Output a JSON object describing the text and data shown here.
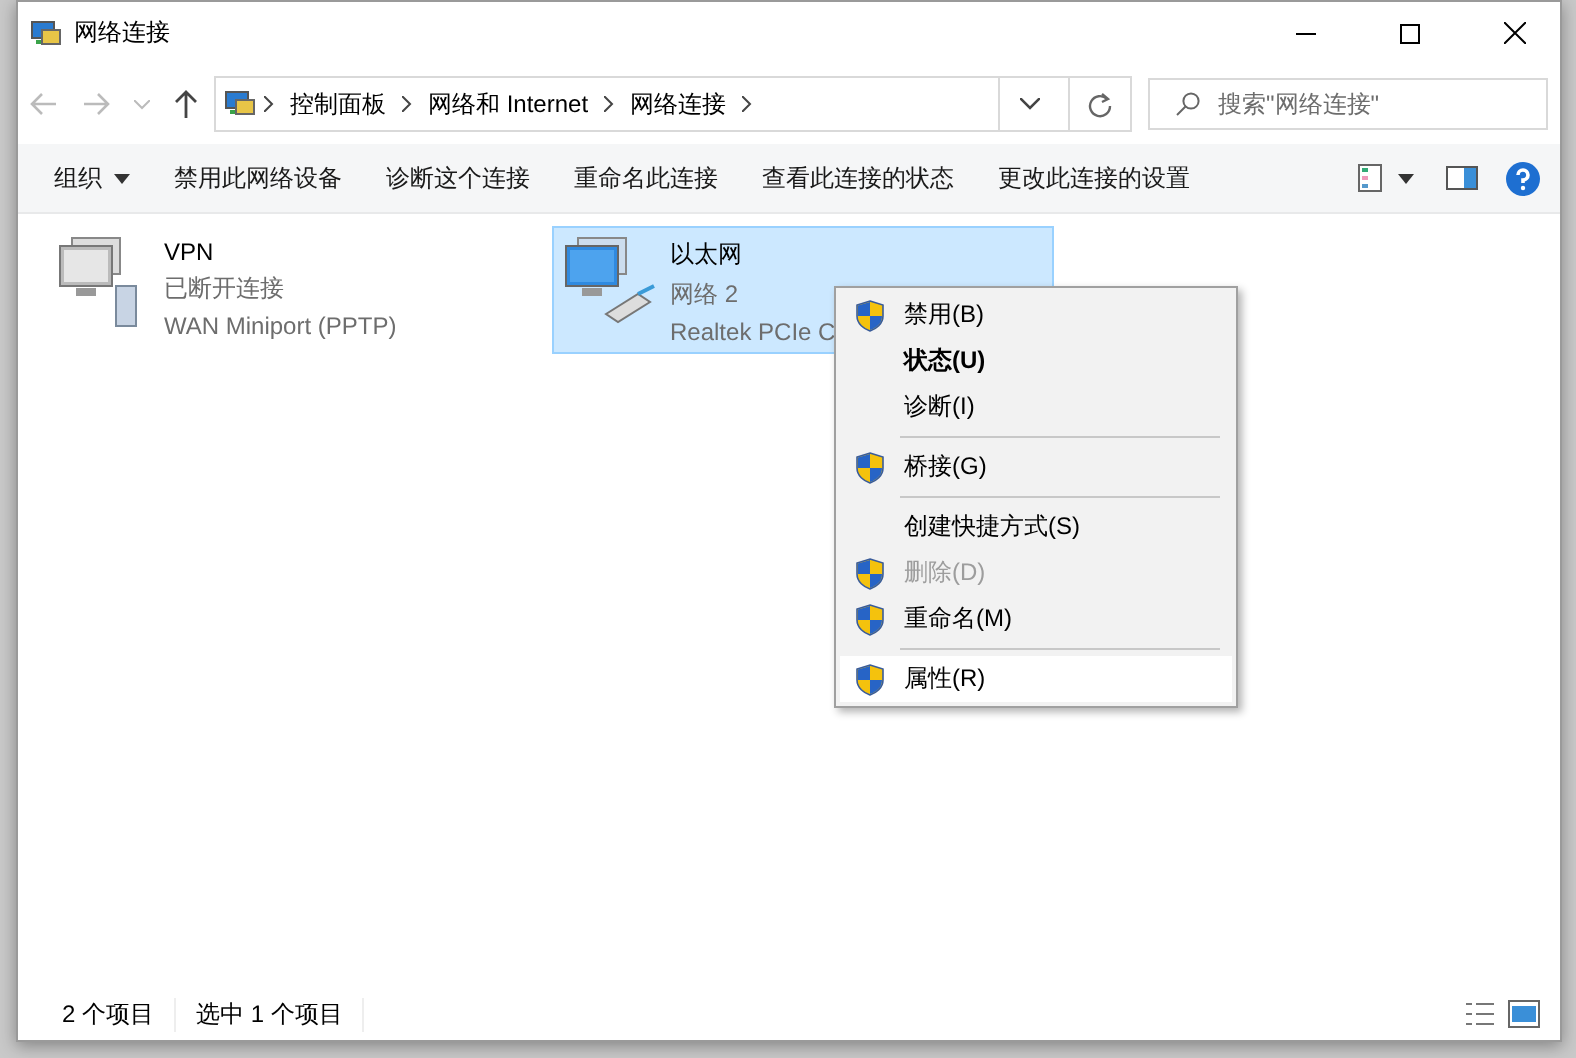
{
  "window": {
    "title": "网络连接"
  },
  "address": {
    "crumbs": [
      "控制面板",
      "网络和 Internet",
      "网络连接"
    ]
  },
  "search": {
    "placeholder": "搜索\"网络连接\""
  },
  "commands": [
    {
      "label": "组织",
      "dropdown": true
    },
    {
      "label": "禁用此网络设备",
      "dropdown": false
    },
    {
      "label": "诊断这个连接",
      "dropdown": false
    },
    {
      "label": "重命名此连接",
      "dropdown": false
    },
    {
      "label": "查看此连接的状态",
      "dropdown": false
    },
    {
      "label": "更改此连接的设置",
      "dropdown": false
    }
  ],
  "items": [
    {
      "kind": "vpn",
      "name": "VPN",
      "status": "已断开连接",
      "device": "WAN Miniport (PPTP)",
      "selected": false
    },
    {
      "kind": "ethernet",
      "name": "以太网",
      "status": "网络 2",
      "device": "Realtek PCIe C",
      "selected": true
    }
  ],
  "context_menu": [
    {
      "kind": "shield",
      "label": "禁用(B)",
      "bold": false,
      "disabled": false,
      "selected": false
    },
    {
      "kind": "plain",
      "label": "状态(U)",
      "bold": true,
      "disabled": false,
      "selected": false
    },
    {
      "kind": "plain",
      "label": "诊断(I)",
      "bold": false,
      "disabled": false,
      "selected": false
    },
    {
      "kind": "separator"
    },
    {
      "kind": "shield",
      "label": "桥接(G)",
      "bold": false,
      "disabled": false,
      "selected": false
    },
    {
      "kind": "separator"
    },
    {
      "kind": "plain",
      "label": "创建快捷方式(S)",
      "bold": false,
      "disabled": false,
      "selected": false
    },
    {
      "kind": "shield",
      "label": "删除(D)",
      "bold": false,
      "disabled": true,
      "selected": false
    },
    {
      "kind": "shield",
      "label": "重命名(M)",
      "bold": false,
      "disabled": false,
      "selected": false
    },
    {
      "kind": "separator"
    },
    {
      "kind": "shield",
      "label": "属性(R)",
      "bold": false,
      "disabled": false,
      "selected": true
    }
  ],
  "status_bar": {
    "count": "2 个项目",
    "selection": "选中 1 个项目"
  }
}
